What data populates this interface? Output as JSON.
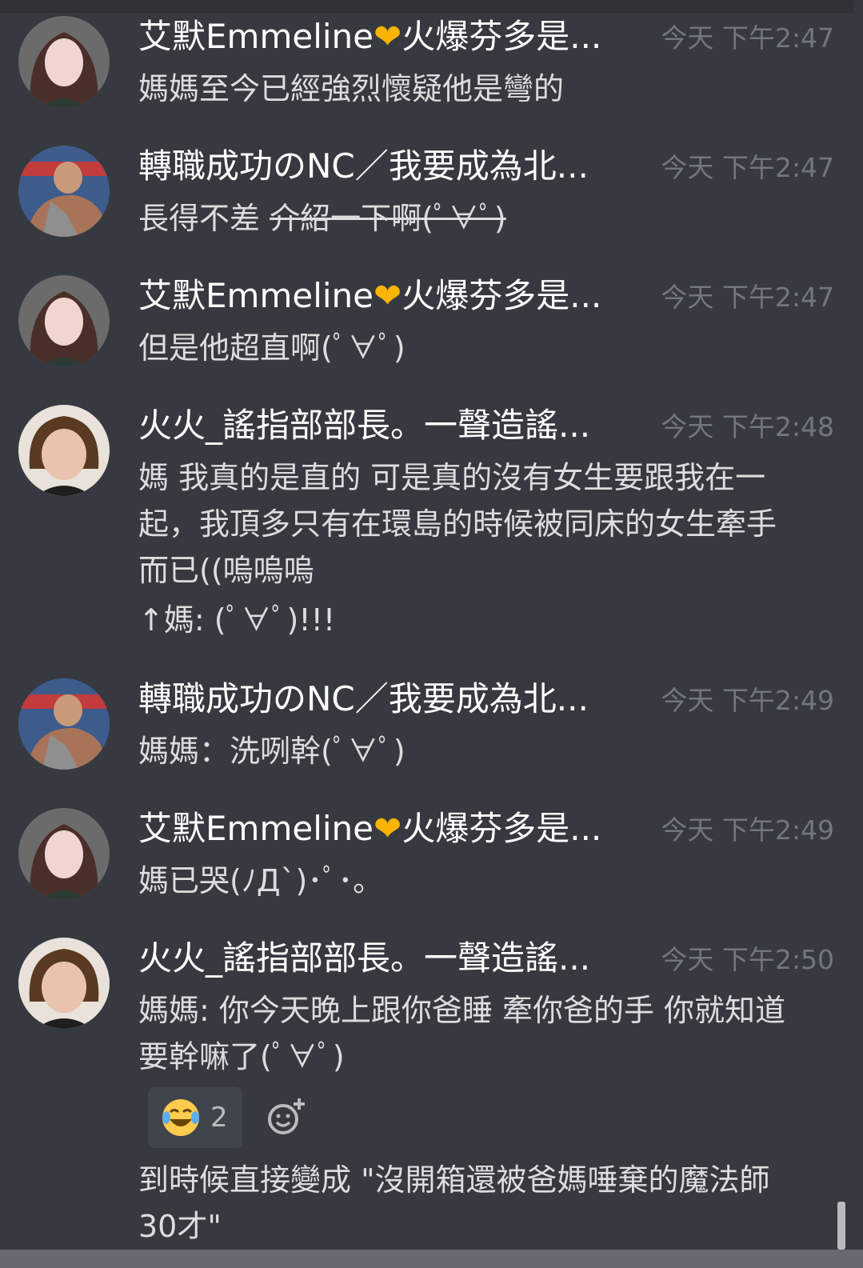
{
  "colors": {
    "background": "#36393f",
    "text": "#dcddde",
    "author": "#ffffff",
    "timestamp": "#72767d",
    "heart": "#f8b400"
  },
  "messages": [
    {
      "author_a": "艾默Emmeline",
      "author_b": "火爆芬多是...",
      "time": "今天 下午2:47",
      "lines": [
        "媽媽至今已經強烈懷疑他是彎的"
      ]
    },
    {
      "author": "轉職成功のNC／我要成為北...",
      "time": "今天 下午2:47",
      "text": "長得不差",
      "strike": "介紹一下啊(ﾟ∀ﾟ)"
    },
    {
      "author_a": "艾默Emmeline",
      "author_b": "火爆芬多是...",
      "time": "今天 下午2:47",
      "lines": [
        "但是他超直啊(ﾟ∀ﾟ)"
      ]
    },
    {
      "author": "火火_謠指部部長。一聲造謠...",
      "time": "今天 下午2:48",
      "lines": [
        "媽 我真的是直的 可是真的沒有女生要跟我在一",
        "起，我頂多只有在環島的時候被同床的女生牽手",
        "而已((嗚嗚嗚",
        "↑媽: (ﾟ∀ﾟ)!!!"
      ]
    },
    {
      "author": "轉職成功のNC／我要成為北...",
      "time": "今天 下午2:49",
      "lines": [
        "媽媽：洗咧幹(ﾟ∀ﾟ)"
      ]
    },
    {
      "author_a": "艾默Emmeline",
      "author_b": "火爆芬多是...",
      "time": "今天 下午2:49",
      "lines": [
        "媽已哭(ﾉД`)･ﾟ･｡"
      ]
    },
    {
      "author": "火火_謠指部部長。一聲造謠...",
      "time": "今天 下午2:50",
      "lines": [
        "媽媽: 你今天晚上跟你爸睡 牽你爸的手 你就知道",
        "要幹嘛了(ﾟ∀ﾟ)"
      ],
      "reaction": {
        "emoji": "joy-emoji",
        "count": "2"
      },
      "followup": [
        "到時候直接變成 \"沒開箱還被爸媽唾棄的魔法師",
        "30才\""
      ]
    }
  ]
}
